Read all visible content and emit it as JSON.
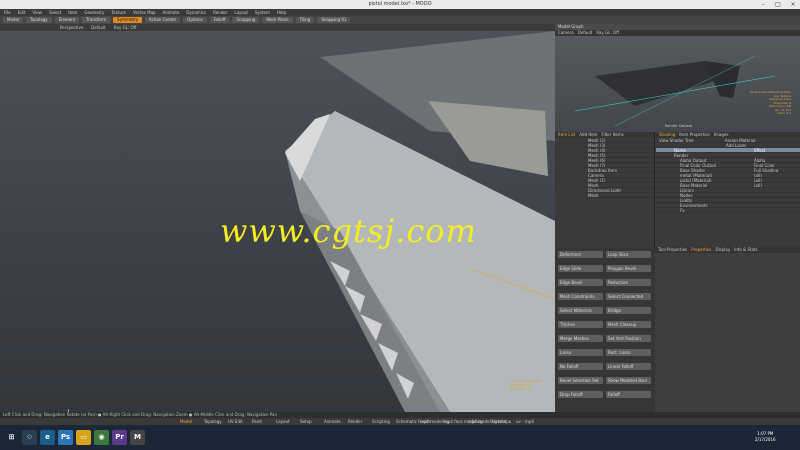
{
  "window": {
    "title": "pistol model.lxo* - MODO"
  },
  "menu": [
    "File",
    "Edit",
    "View",
    "Select",
    "Item",
    "Geometry",
    "Texture",
    "Vertex Map",
    "Animate",
    "Dynamics",
    "Render",
    "Layout",
    "System",
    "Help"
  ],
  "toolbar": {
    "items": [
      "Model",
      "Topology",
      "Element",
      "Transform",
      "Symmetry",
      "Action Center",
      "Options",
      "Falloff",
      "Snapping",
      "Work Plane",
      "Tiling",
      "Snapping 01"
    ]
  },
  "viewport": {
    "header": [
      "Perspective",
      "Default",
      "Ray GL: Off"
    ],
    "info": [
      "No items selected",
      "Channels: 0",
      "Polygons: 0"
    ]
  },
  "preview": {
    "title": "Model Graph",
    "tabs": [
      "Camera",
      "Default",
      "Ray GL: Off"
    ],
    "info": [
      "Perspective Reference Item",
      "GL: Texture",
      "Polygons: Face",
      "Channels: 0",
      "Deformers: ON",
      "GL: 31,272",
      "Item: 0.1"
    ],
    "label": "Render Camera"
  },
  "itemlist": {
    "tabs": [
      "Item List",
      "Add Item",
      "Filter Items"
    ],
    "items": [
      "Mesh (2)",
      "Mesh (3)",
      "Mesh (4)",
      "Mesh (5)",
      "Mesh (6)",
      "Mesh (7)",
      "Backdrop Item",
      "Camera",
      "Mesh (1)",
      "Mesh",
      "Directional Light",
      "Mesh"
    ]
  },
  "shader": {
    "tabs": [
      "Shading",
      "Item Properties",
      "Images"
    ],
    "view": "Shader Tree",
    "filter": "Assign Material",
    "add": "Add Layer",
    "cols": [
      "Name",
      "Effect"
    ],
    "rows": [
      [
        "Render",
        ""
      ],
      [
        "Alpha Output",
        "Alpha"
      ],
      [
        "Final Color Output",
        "Final Color"
      ],
      [
        "Base Shader",
        "Full Shading"
      ],
      [
        "metal (Material)",
        "(all)"
      ],
      [
        "pistol (Material)",
        "(all)"
      ],
      [
        "Base Material",
        "(all)"
      ],
      [
        "Library",
        ""
      ],
      [
        "Nodes",
        ""
      ],
      [
        "Lights",
        ""
      ],
      [
        "Environments",
        ""
      ],
      [
        "Fx",
        ""
      ]
    ]
  },
  "tools": {
    "sections": [
      "Deformers",
      "Duplicate",
      "Selection",
      "Edit",
      "Create",
      "Mesh Cleanup",
      "Curves",
      "Reset Tools"
    ],
    "buttons": [
      "Deformers",
      "Loop Slice",
      "Edge Slide",
      "Polygon Bevel",
      "Edge Bevel",
      "Reduction",
      "Mesh Constraints",
      "Select Connected",
      "Select Materials",
      "Bridge",
      "Thicken",
      "Mesh Cleanup",
      "Merge Meshes",
      "Set Vert Position",
      "Lasso",
      "Rect. Lasso",
      "No Falloff",
      "Linear Falloff",
      "Bevel Selection Set",
      "Show Modeled Bars",
      "Drop Falloff",
      "Falloff"
    ]
  },
  "status": "Left Click and Drag: Navigation Rotate (or Pan) ● Alt-Right Click and Drag: Navigation Zoom ● Alt-Middle Click and Drag: Navigation Pan",
  "layouts": [
    "Model",
    "Topology",
    "UV Edit",
    "Paint",
    "Layout",
    "Setup",
    "Animate",
    "Render",
    "Scripting",
    "Schematic Fusion",
    "mp4 modeling",
    "mp4 face modeling",
    "mp4 modeling retopo",
    "Unbind",
    "uv - mp4"
  ],
  "taskbar": {
    "time": "1:07 PM",
    "date": "2/17/2016",
    "search": "Ask me anything"
  },
  "watermark": "www.cgtsj.com",
  "colors": {
    "accent": "#f2a640",
    "watermark": "#f2ee21",
    "selection": "#7a8aa0"
  }
}
